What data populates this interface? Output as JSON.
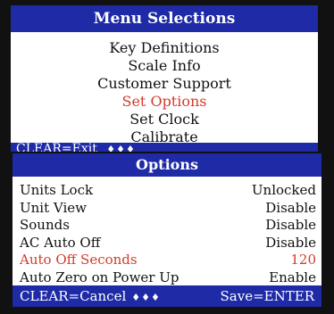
{
  "menu": {
    "title": "Menu Selections",
    "items": [
      {
        "label": "Key Definitions",
        "selected": false
      },
      {
        "label": "Scale Info",
        "selected": false
      },
      {
        "label": "Customer Support",
        "selected": false
      },
      {
        "label": "Set Options",
        "selected": true
      },
      {
        "label": "Set Clock",
        "selected": false
      },
      {
        "label": "Calibrate",
        "selected": false
      }
    ],
    "footer": "CLEAR=Exit",
    "footer_arrows": "♦♦♦"
  },
  "options": {
    "title": "Options",
    "rows": [
      {
        "label": "Units Lock",
        "value": "Unlocked",
        "selected": false
      },
      {
        "label": "Unit View",
        "value": "Disable",
        "selected": false
      },
      {
        "label": "Sounds",
        "value": "Disable",
        "selected": false
      },
      {
        "label": "AC Auto Off",
        "value": "Disable",
        "selected": false
      },
      {
        "label": "Auto Off Seconds",
        "value": "120",
        "selected": true
      },
      {
        "label": "Auto Zero on Power Up",
        "value": "Enable",
        "selected": false
      }
    ],
    "footer_left": "CLEAR=Cancel",
    "footer_arrows": "♦♦♦",
    "footer_right": "Save=ENTER"
  },
  "colors": {
    "titlebar": "#1e2aa6",
    "selected": "#d43a2a",
    "text": "#111111",
    "background": "#ffffff"
  }
}
